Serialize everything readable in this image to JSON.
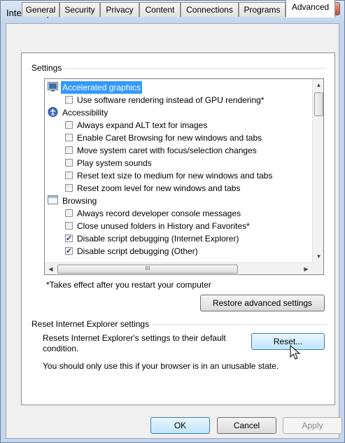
{
  "window": {
    "title": "Internet Options",
    "help_glyph": "?",
    "close_glyph": "X"
  },
  "tabs": [
    {
      "label": "General"
    },
    {
      "label": "Security"
    },
    {
      "label": "Privacy"
    },
    {
      "label": "Content"
    },
    {
      "label": "Connections"
    },
    {
      "label": "Programs"
    },
    {
      "label": "Advanced",
      "active": true
    }
  ],
  "settings": {
    "group_label": "Settings",
    "tree": [
      {
        "type": "category",
        "icon": "display-icon",
        "label": "Accelerated graphics",
        "selected": true
      },
      {
        "type": "checkbox",
        "label": "Use software rendering instead of GPU rendering*",
        "checked": false
      },
      {
        "type": "category",
        "icon": "accessibility-icon",
        "label": "Accessibility"
      },
      {
        "type": "checkbox",
        "label": "Always expand ALT text for images",
        "checked": false
      },
      {
        "type": "checkbox",
        "label": "Enable Caret Browsing for new windows and tabs",
        "checked": false
      },
      {
        "type": "checkbox",
        "label": "Move system caret with focus/selection changes",
        "checked": false
      },
      {
        "type": "checkbox",
        "label": "Play system sounds",
        "checked": false
      },
      {
        "type": "checkbox",
        "label": "Reset text size to medium for new windows and tabs",
        "checked": false
      },
      {
        "type": "checkbox",
        "label": "Reset zoom level for new windows and tabs",
        "checked": false
      },
      {
        "type": "category",
        "icon": "browsing-icon",
        "label": "Browsing"
      },
      {
        "type": "checkbox",
        "label": "Always record developer console messages",
        "checked": false
      },
      {
        "type": "checkbox",
        "label": "Close unused folders in History and Favorites*",
        "checked": false
      },
      {
        "type": "checkbox",
        "label": "Disable script debugging (Internet Explorer)",
        "checked": true
      },
      {
        "type": "checkbox",
        "label": "Disable script debugging (Other)",
        "checked": true
      }
    ],
    "hscroll_grip": "III",
    "footnote": "*Takes effect after you restart your computer",
    "restore_button": "Restore advanced settings"
  },
  "reset": {
    "group_label": "Reset Internet Explorer settings",
    "description_line1": "Resets Internet Explorer's settings to their default",
    "description_line2": "condition.",
    "reset_button": "Reset...",
    "warning": "You should only use this if your browser is in an unusable state."
  },
  "footer": {
    "ok": "OK",
    "cancel": "Cancel",
    "apply": "Apply"
  }
}
